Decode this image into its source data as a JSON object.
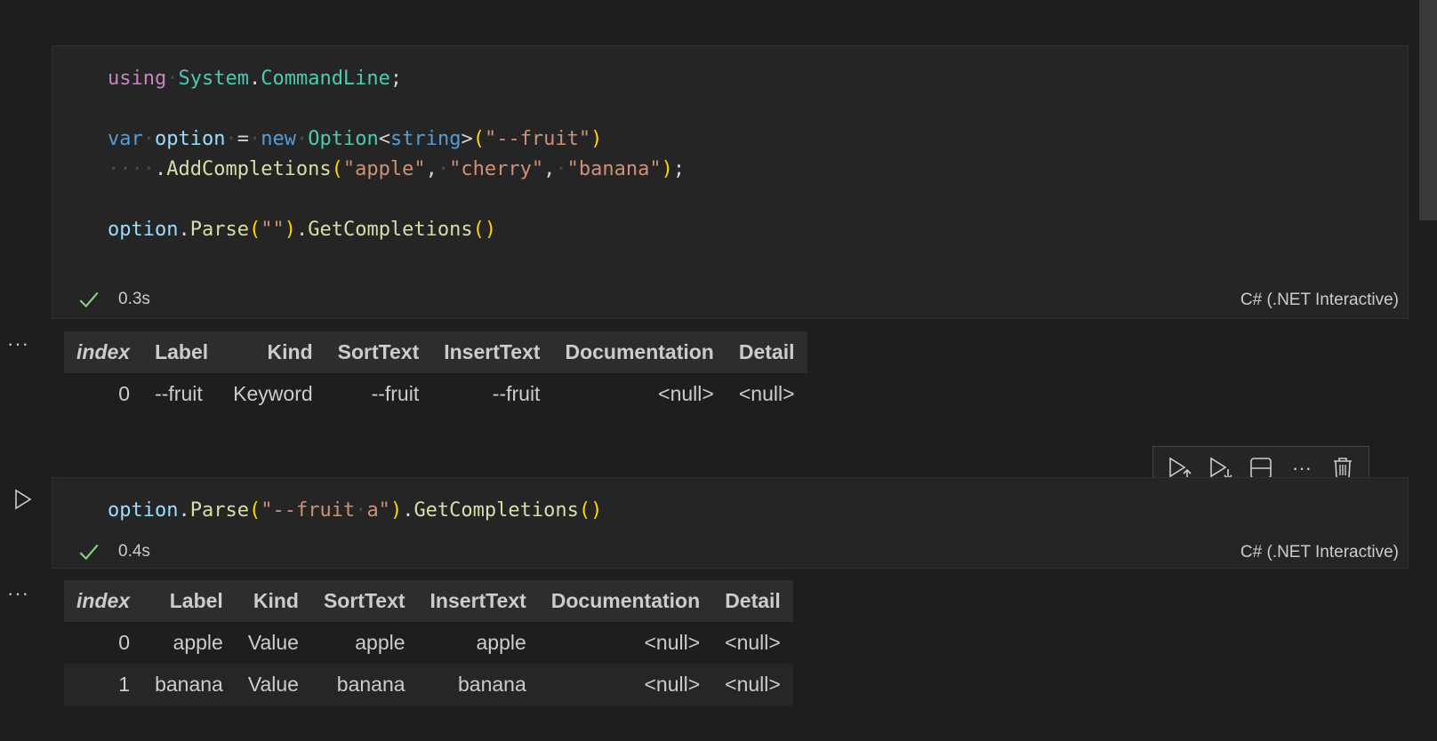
{
  "cells": [
    {
      "code_lines": [
        "using System.CommandLine;",
        "",
        "var option = new Option<string>(\"--fruit\")",
        "    .AddCompletions(\"apple\", \"cherry\", \"banana\");",
        "",
        "option.Parse(\"\").GetCompletions()"
      ],
      "duration": "0.3s",
      "language": "C# (.NET Interactive)",
      "output": {
        "headers": [
          "index",
          "Label",
          "Kind",
          "SortText",
          "InsertText",
          "Documentation",
          "Detail"
        ],
        "rows": [
          [
            "0",
            "--fruit",
            "Keyword",
            "--fruit",
            "--fruit",
            "<null>",
            "<null>"
          ]
        ]
      }
    },
    {
      "code_lines": [
        "option.Parse(\"--fruit a\").GetCompletions()"
      ],
      "duration": "0.4s",
      "language": "C# (.NET Interactive)",
      "output": {
        "headers": [
          "index",
          "Label",
          "Kind",
          "SortText",
          "InsertText",
          "Documentation",
          "Detail"
        ],
        "rows": [
          [
            "0",
            "apple",
            "Value",
            "apple",
            "apple",
            "<null>",
            "<null>"
          ],
          [
            "1",
            "banana",
            "Value",
            "banana",
            "banana",
            "<null>",
            "<null>"
          ]
        ]
      }
    }
  ],
  "output_menu_label": "···",
  "toolbar": {
    "icons": [
      "run-above-icon",
      "run-below-icon",
      "split-cell-icon",
      "more-actions-icon",
      "delete-cell-icon"
    ],
    "more_label": "···"
  },
  "icons": {
    "status": "check-icon",
    "run": "play-icon"
  },
  "colors": {
    "background": "#1e1e1e",
    "cell_background": "#252526",
    "success": "#89d185",
    "keyword_pink": "#c586c0",
    "keyword_blue": "#569cd6",
    "type": "#4ec9b0",
    "variable": "#9cdcfe",
    "function": "#dcdcaa",
    "string": "#ce9178"
  }
}
